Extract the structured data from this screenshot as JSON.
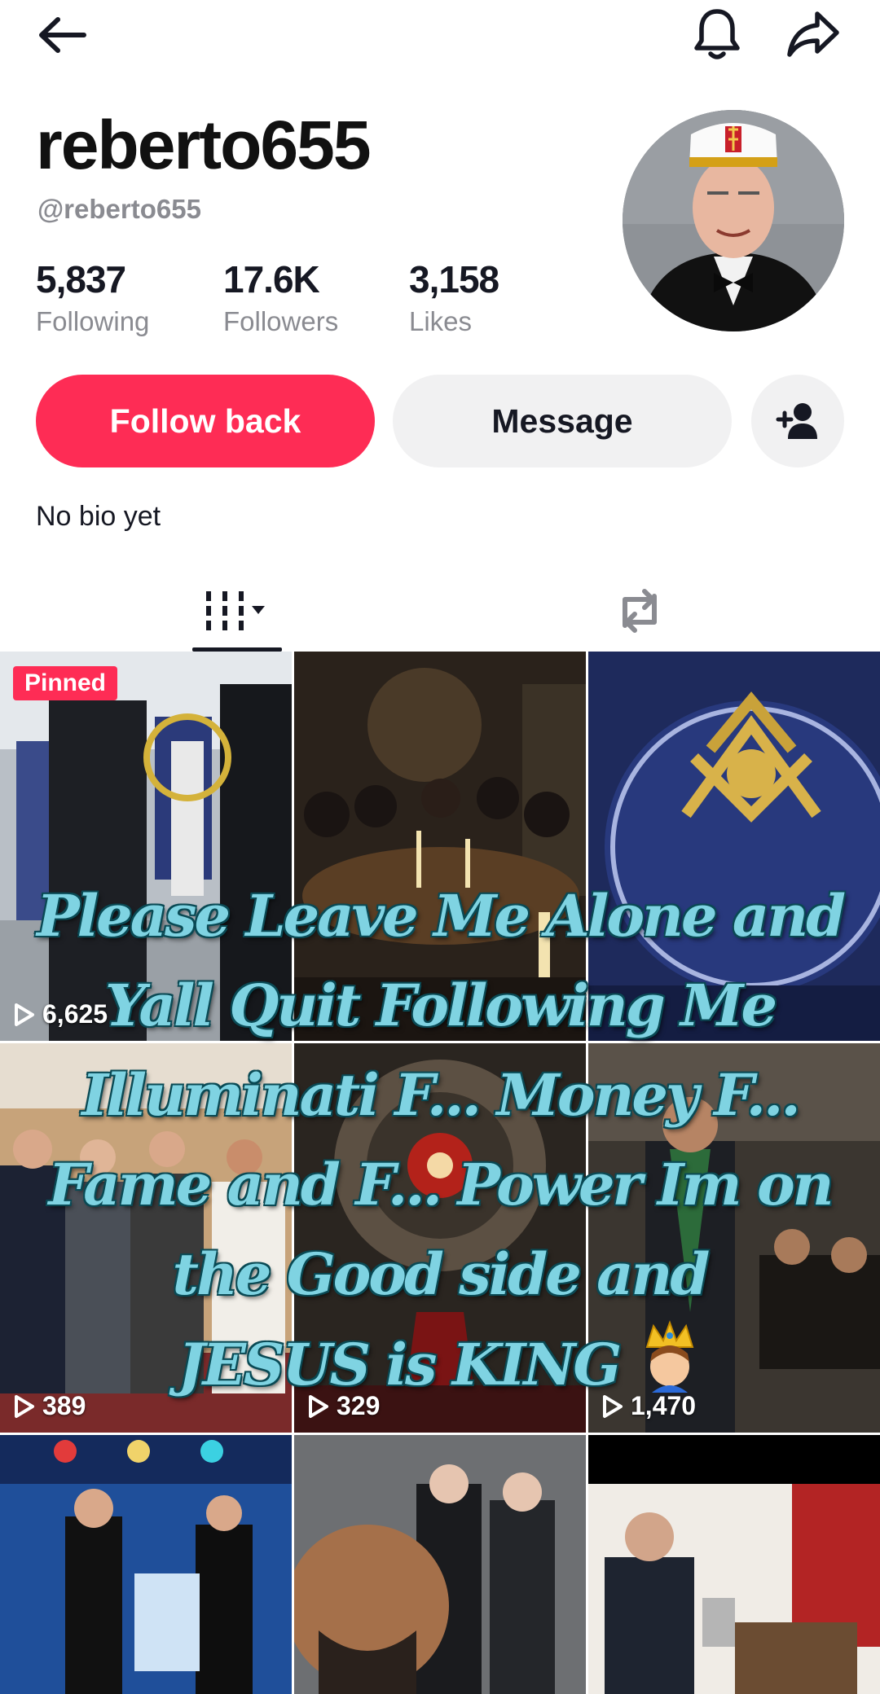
{
  "profile": {
    "username": "reberto655",
    "handle": "@reberto655",
    "bio": "No bio yet"
  },
  "stats": {
    "following_value": "5,837",
    "following_label": "Following",
    "followers_value": "17.6K",
    "followers_label": "Followers",
    "likes_value": "3,158",
    "likes_label": "Likes"
  },
  "actions": {
    "follow_label": "Follow back",
    "message_label": "Message"
  },
  "tabs": [
    {
      "name": "videos-grid",
      "icon": "grid-icon",
      "selected": true
    },
    {
      "name": "reposts",
      "icon": "repost-icon",
      "selected": false
    }
  ],
  "videos": [
    {
      "views": "6,625",
      "badge": "Pinned"
    },
    {
      "views": "",
      "badge": ""
    },
    {
      "views": "",
      "badge": ""
    },
    {
      "views": "389",
      "badge": ""
    },
    {
      "views": "329",
      "badge": ""
    },
    {
      "views": "1,470",
      "badge": ""
    },
    {
      "views": "",
      "badge": ""
    },
    {
      "views": "",
      "badge": ""
    },
    {
      "views": "",
      "badge": ""
    }
  ],
  "overlay": {
    "line1": "Please Leave Me Alone and",
    "line2": "Yall Quit Following Me",
    "line3": "Illuminati F... Money F...",
    "line4": "Fame and F... Power Im on",
    "line5": "the Good side and",
    "line6": "JESUS is KING"
  },
  "colors": {
    "accent": "#fe2c55",
    "secondary_button": "#f1f1f2",
    "muted_text": "#8a8b91",
    "caption_fill": "#7fd3e2",
    "caption_outline": "#0a4a55"
  }
}
